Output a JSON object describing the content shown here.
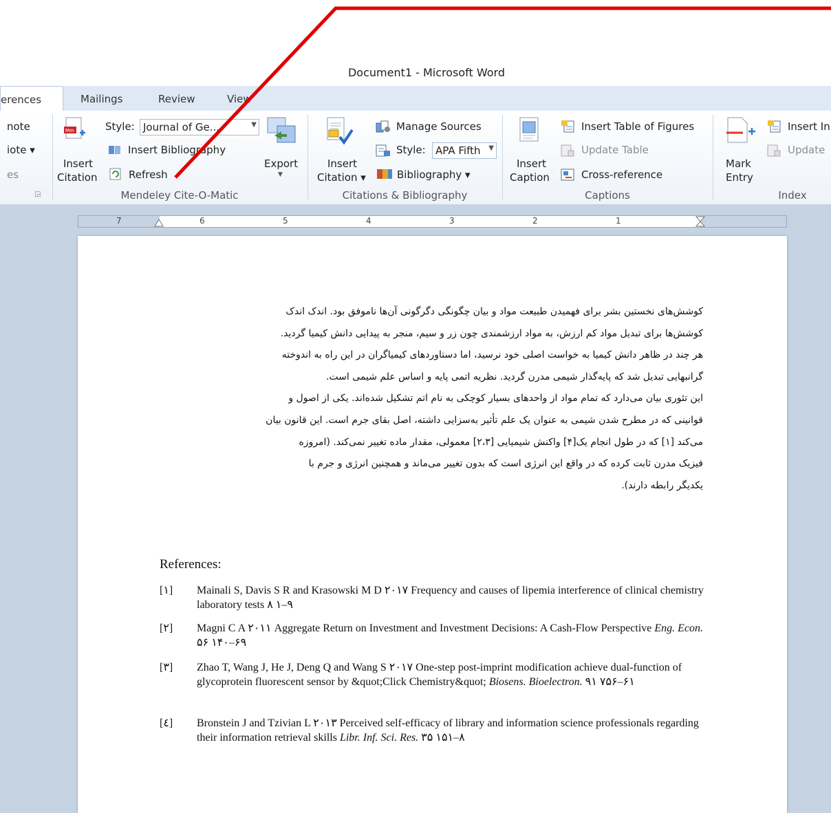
{
  "window": {
    "title": "Document1  -  Microsoft Word"
  },
  "tabs": [
    "erences",
    "Mailings",
    "Review",
    "View"
  ],
  "ribbon": {
    "footnote_items": [
      "note",
      "iote ▾",
      "es"
    ],
    "mendeley": {
      "insert_citation": [
        "Insert",
        "Citation"
      ],
      "style_label": "Style:",
      "style_value": "Journal of Ge...",
      "insert_bibliography": "Insert Bibliography",
      "refresh": "Refresh",
      "export": "Export",
      "group": "Mendeley Cite-O-Matic"
    },
    "citations": {
      "insert_citation": [
        "Insert",
        "Citation ▾"
      ],
      "manage_sources": "Manage Sources",
      "style_label": "Style:",
      "style_value": "APA Fifth",
      "bibliography": "Bibliography ▾",
      "group": "Citations & Bibliography"
    },
    "captions": {
      "insert_caption": [
        "Insert",
        "Caption"
      ],
      "insert_table_of_figures": "Insert Table of Figures",
      "update_table": "Update Table",
      "cross_reference": "Cross-reference",
      "group": "Captions"
    },
    "index": {
      "mark_entry": [
        "Mark",
        "Entry"
      ],
      "insert_index": "Insert In",
      "update": "Update",
      "group": "Index"
    }
  },
  "ruler": {
    "numbers": [
      "7",
      "6",
      "5",
      "4",
      "3",
      "2",
      "1"
    ]
  },
  "document": {
    "paragraph_lines": [
      "کوشش‌های نخستین بشر برای فهمیدن طبیعت مواد و بیان چگونگی دگرگونی آن‌ها ناموفق بود. اندک اندک",
      "کوشش‌ها برای تبدیل مواد کم ارزش، به مواد ارزشمندی چون زر و سیم، منجر به پیدایی دانش کیمیا گردید.",
      "هر چند در ظاهر دانش کیمیا به خواست اصلی خود نرسید، اما دستاوردهای کیمیاگران در این راه به اندوخته",
      "گرانبهایی تبدیل شد که پایه‌گذار شیمی مدرن گردید. نظریه اتمی پایه و اساس علم شیمی است.",
      "این تئوری بیان می‌دارد که تمام مواد از واحدهای بسیار کوچکی به نام اتم تشکیل شده‌اند. یکی از اصول و",
      "قوانینی که در مطرح شدن شیمی به عنوان یک علم تأثیر به‌سزایی داشته، اصل بقای جرم است. این قانون بیان",
      "می‌کند [۱] که در طول انجام یک[۴] واکنش شیمیایی [۲،۳] معمولی، مقدار ماده تغییر نمی‌کند. (امروزه",
      "فیزیک مدرن ثابت کرده که در واقع این انرژی است که بدون تغییر می‌ماند و همچنین انرژی و جرم با",
      "یکدیگر رابطه دارند)."
    ],
    "references_heading": "References:",
    "references": [
      {
        "num": "[۱]",
        "text": "Mainali S, Davis S R and Krasowski M D ۲۰۱۷ Frequency and causes of lipemia interference of clinical chemistry laboratory tests ۸ ۱–۹",
        "journal": ""
      },
      {
        "num": "[۲]",
        "text": "Magni C A ۲۰۱۱ Aggregate Return on Investment and Investment Decisions: A Cash-Flow Perspective",
        "journal": "Eng. Econ.",
        "tail": "۵۶ ۱۴۰–۶۹"
      },
      {
        "num": "[۳]",
        "text": "Zhao T, Wang J, He J, Deng Q and Wang S ۲۰۱۷ One-step post-imprint modification achieve dual-function of glycoprotein fluorescent sensor by &quot;Click Chemistry&quot;",
        "journal": "Biosens. Bioelectron.",
        "tail": "۹۱ ۷۵۶–۶۱"
      },
      {
        "num": "[٤]",
        "text": "Bronstein J and Tzivian L ۲۰۱۳ Perceived self-efficacy of library and information science professionals regarding their information retrieval skills",
        "journal": "Libr. Inf. Sci. Res.",
        "tail": "۳۵ ۱۵۱–۸"
      }
    ]
  },
  "colors": {
    "accent_line": "#e00000",
    "ribbon_bg": "#dfe9f5",
    "workspace": "#c6d3e2"
  }
}
